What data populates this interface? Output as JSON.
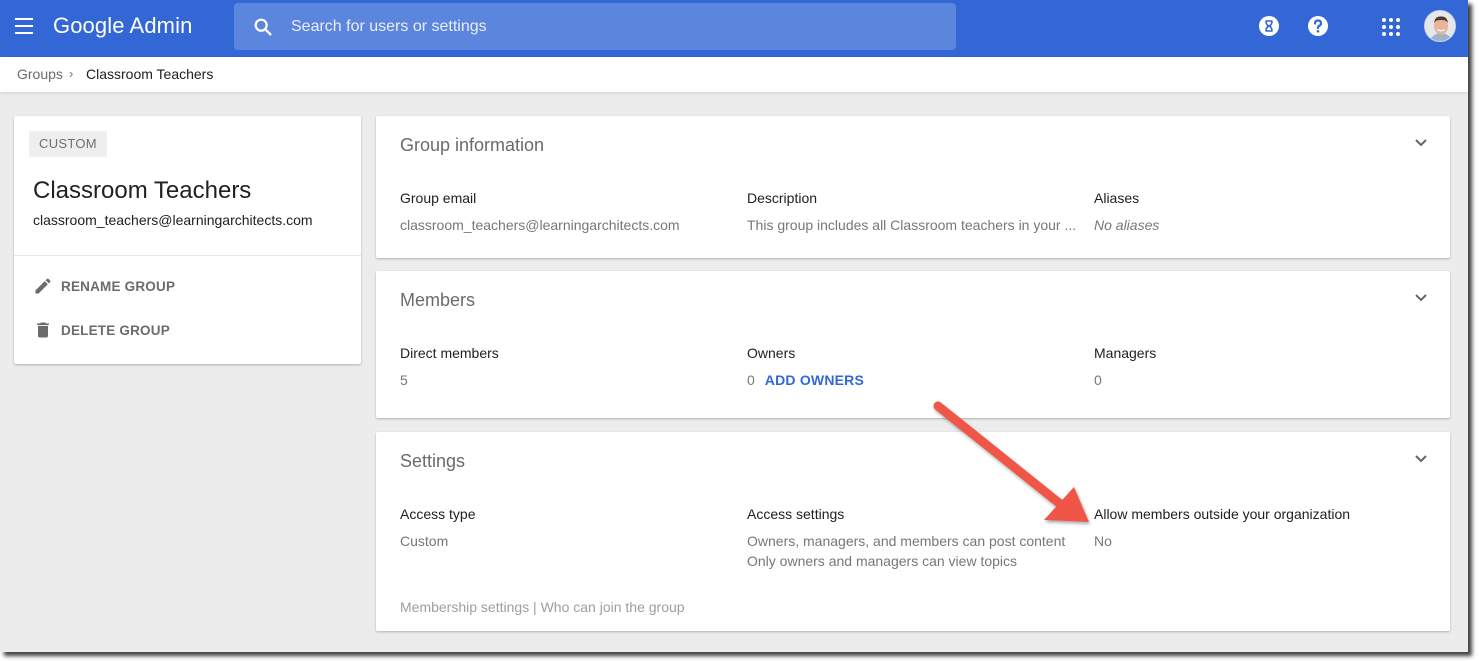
{
  "header": {
    "app_title": "Google Admin",
    "search_placeholder": "Search for users or settings",
    "icons": [
      "menu-icon",
      "search-icon",
      "timer-icon",
      "help-icon",
      "apps-grid-icon",
      "avatar"
    ],
    "accent_color": "#3367d6"
  },
  "breadcrumb": {
    "root": "Groups",
    "separator": "›",
    "current": "Classroom Teachers"
  },
  "group_card": {
    "badge": "CUSTOM",
    "name": "Classroom Teachers",
    "email": "classroom_teachers@learningarchitects.com",
    "actions": [
      {
        "label": "RENAME GROUP",
        "icon": "pencil-icon"
      },
      {
        "label": "DELETE GROUP",
        "icon": "trash-icon"
      }
    ]
  },
  "group_information": {
    "title": "Group information",
    "fields": [
      {
        "label": "Group email",
        "value": "classroom_teachers@learningarchitects.com"
      },
      {
        "label": "Description",
        "value": "This group includes all Classroom teachers in your ..."
      },
      {
        "label": "Aliases",
        "value": "No aliases"
      }
    ]
  },
  "members": {
    "title": "Members",
    "fields": [
      {
        "label": "Direct members",
        "value": "5"
      },
      {
        "label": "Owners",
        "value": "0",
        "action": "ADD OWNERS"
      },
      {
        "label": "Managers",
        "value": "0"
      }
    ]
  },
  "settings": {
    "title": "Settings",
    "fields": [
      {
        "label": "Access type",
        "value": "Custom"
      },
      {
        "label": "Access settings",
        "lines": [
          "Owners, managers, and members can post content",
          "Only owners and managers can view topics"
        ]
      },
      {
        "label": "Allow members outside your organization",
        "value": "No"
      }
    ],
    "footer": {
      "membership_settings": "Membership settings",
      "separator": " | ",
      "who_can_join": "Who can join the group"
    }
  },
  "annotation": {
    "type": "arrow",
    "color": "#ef5647",
    "points_to": "Allow members outside your organization"
  }
}
